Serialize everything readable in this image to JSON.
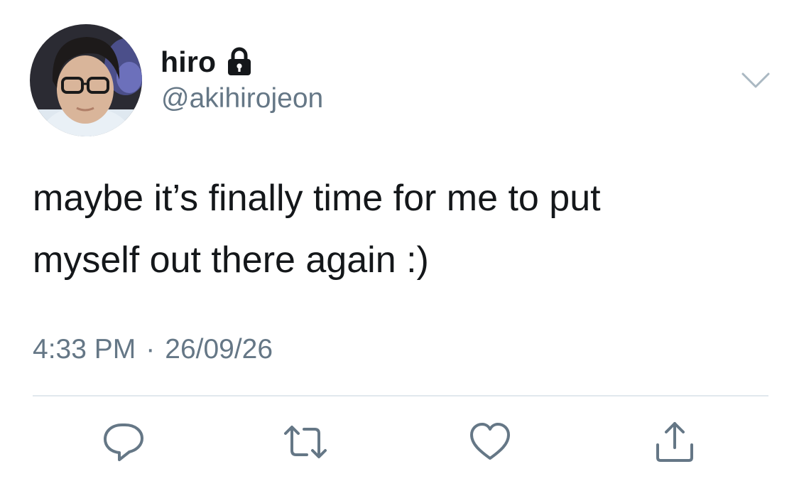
{
  "user": {
    "display_name": "hiro",
    "handle": "@akihirojeon",
    "protected_icon": "lock-icon",
    "avatar": "profile-photo"
  },
  "tweet": {
    "text": "maybe it’s finally time for me to put\nmyself out there again :)",
    "time": "4:33 PM",
    "separator": "·",
    "date": "26/09/26"
  },
  "actions": [
    {
      "name": "reply",
      "icon": "comment-icon"
    },
    {
      "name": "retweet",
      "icon": "retweet-icon"
    },
    {
      "name": "like",
      "icon": "heart-icon"
    },
    {
      "name": "share",
      "icon": "share-icon"
    }
  ],
  "menu": {
    "icon": "chevron-down-icon"
  },
  "colors": {
    "text": "#14171a",
    "secondary": "#657786",
    "divider": "#e1e8ed",
    "icon": "#657786"
  }
}
